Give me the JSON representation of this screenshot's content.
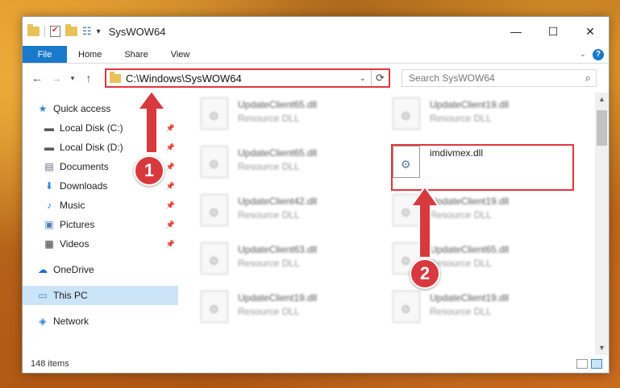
{
  "window": {
    "title": "SysWOW64",
    "controls": {
      "minimize": "—",
      "maximize": "☐",
      "close": "✕"
    }
  },
  "ribbon": {
    "file": "File",
    "tabs": [
      "Home",
      "Share",
      "View"
    ]
  },
  "address": {
    "path": "C:\\Windows\\SysWOW64",
    "refresh_icon": "⟳"
  },
  "search": {
    "placeholder": "Search SysWOW64"
  },
  "sidebar": {
    "quick_access": "Quick access",
    "items": [
      {
        "label": "Local Disk (C:)",
        "icon": "disk-icon"
      },
      {
        "label": "Local Disk (D:)",
        "icon": "disk-icon"
      },
      {
        "label": "Documents",
        "icon": "documents-icon"
      },
      {
        "label": "Downloads",
        "icon": "downloads-icon"
      },
      {
        "label": "Music",
        "icon": "music-icon"
      },
      {
        "label": "Pictures",
        "icon": "pictures-icon"
      },
      {
        "label": "Videos",
        "icon": "videos-icon"
      }
    ],
    "onedrive": "OneDrive",
    "this_pc": "This PC",
    "network": "Network"
  },
  "files": {
    "left": [
      {
        "name": "UpdateClient65.dll",
        "type": "Resource DLL"
      },
      {
        "name": "UpdateClient65.dll",
        "type": "Resource DLL"
      },
      {
        "name": "UpdateClient42.dll",
        "type": "Resource DLL"
      },
      {
        "name": "UpdateClient63.dll",
        "type": "Resource DLL"
      },
      {
        "name": "UpdateClient19.dll",
        "type": "Resource DLL"
      }
    ],
    "right": [
      {
        "name": "UpdateClient19.dll",
        "type": "Resource DLL"
      },
      {
        "name": "imdivmex.dll",
        "type": ""
      },
      {
        "name": "UpdateClient19.dll",
        "type": "Resource DLL"
      },
      {
        "name": "UpdateClient65.dll",
        "type": "Resource DLL"
      },
      {
        "name": "UpdateClient19.dll",
        "type": "Resource DLL"
      }
    ]
  },
  "status": {
    "items": "148 items"
  },
  "markers": {
    "one": "1",
    "two": "2"
  },
  "colors": {
    "accent": "#1979ca",
    "highlight": "#e0373e",
    "selection": "#cce4f7"
  }
}
